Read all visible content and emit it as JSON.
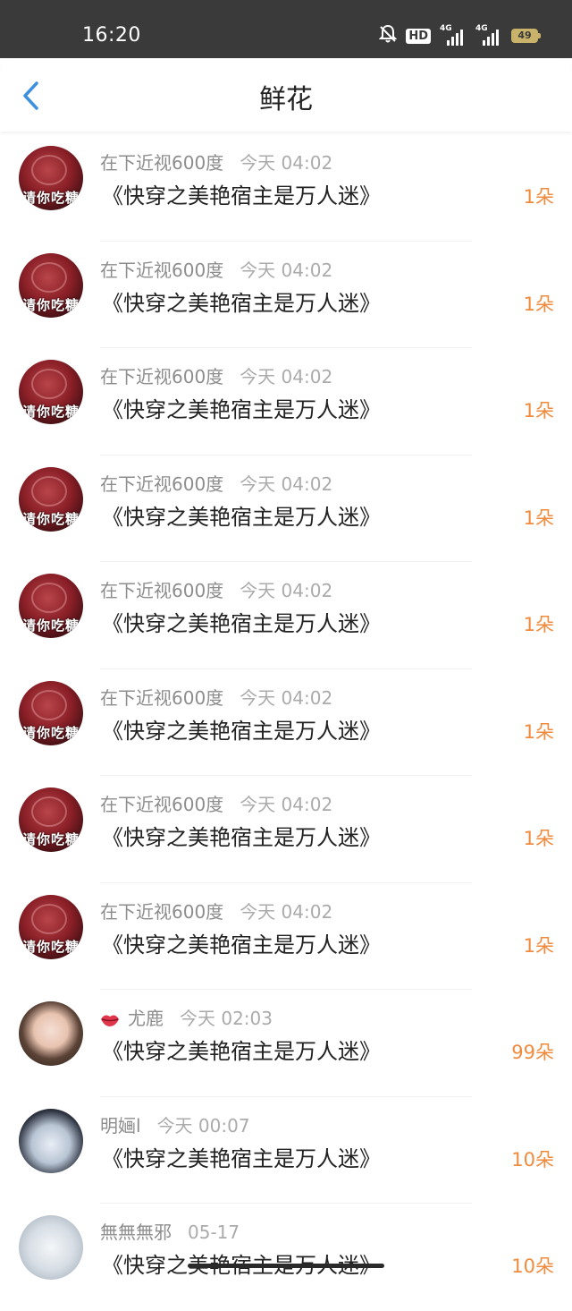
{
  "status_bar": {
    "time": "16:20",
    "hd_label": "HD",
    "network_1": "4G",
    "network_2": "4G",
    "battery": "49",
    "icons": [
      "bell-off-icon",
      "hd-icon",
      "signal-icon",
      "signal-icon",
      "battery-icon"
    ]
  },
  "header": {
    "title": "鲜花",
    "back_icon": "chevron-left-icon"
  },
  "rows": [
    {
      "name": "在下近视600度",
      "time": "今天 04:02",
      "book": "《快穿之美艳宿主是万人迷》",
      "count": "1朵",
      "avatar": "red",
      "avatar_text": "请你吃糖"
    },
    {
      "name": "在下近视600度",
      "time": "今天 04:02",
      "book": "《快穿之美艳宿主是万人迷》",
      "count": "1朵",
      "avatar": "red",
      "avatar_text": "请你吃糖"
    },
    {
      "name": "在下近视600度",
      "time": "今天 04:02",
      "book": "《快穿之美艳宿主是万人迷》",
      "count": "1朵",
      "avatar": "red",
      "avatar_text": "请你吃糖"
    },
    {
      "name": "在下近视600度",
      "time": "今天 04:02",
      "book": "《快穿之美艳宿主是万人迷》",
      "count": "1朵",
      "avatar": "red",
      "avatar_text": "请你吃糖"
    },
    {
      "name": "在下近视600度",
      "time": "今天 04:02",
      "book": "《快穿之美艳宿主是万人迷》",
      "count": "1朵",
      "avatar": "red",
      "avatar_text": "请你吃糖"
    },
    {
      "name": "在下近视600度",
      "time": "今天 04:02",
      "book": "《快穿之美艳宿主是万人迷》",
      "count": "1朵",
      "avatar": "red",
      "avatar_text": "请你吃糖"
    },
    {
      "name": "在下近视600度",
      "time": "今天 04:02",
      "book": "《快穿之美艳宿主是万人迷》",
      "count": "1朵",
      "avatar": "red",
      "avatar_text": "请你吃糖"
    },
    {
      "name": "在下近视600度",
      "time": "今天 04:02",
      "book": "《快穿之美艳宿主是万人迷》",
      "count": "1朵",
      "avatar": "red",
      "avatar_text": "请你吃糖"
    },
    {
      "name": "尤鹿",
      "time": "今天 02:03",
      "book": "《快穿之美艳宿主是万人迷》",
      "count": "99朵",
      "avatar": "girl",
      "badge_icon": "lips-icon"
    },
    {
      "name": "明婳l",
      "time": "今天 00:07",
      "book": "《快穿之美艳宿主是万人迷》",
      "count": "10朵",
      "avatar": "anime"
    },
    {
      "name": "無無無邪",
      "time": "05-17",
      "book": "《快穿之美艳宿主是万人迷》",
      "count": "10朵",
      "avatar": "white"
    }
  ],
  "colors": {
    "accent_blue": "#3d8fe0",
    "count_orange": "#f08a3c",
    "status_bar_bg": "#3a3a3a"
  }
}
